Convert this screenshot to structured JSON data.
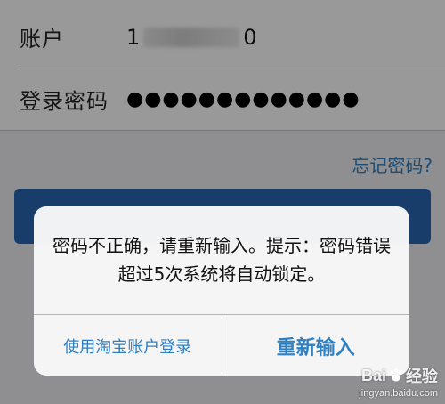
{
  "form": {
    "account": {
      "label": "账户",
      "value_prefix": "1",
      "value_suffix": "0"
    },
    "password": {
      "label": "登录密码",
      "masked_value": "●●●●●●●●●●●●●"
    }
  },
  "forgot_password_link": "忘记密码?",
  "alert": {
    "message": "密码不正确，请重新输入。提示：密码错误超过5次系统将自动锁定。",
    "buttons": {
      "secondary": "使用淘宝账户登录",
      "primary": "重新输入"
    }
  },
  "watermark": {
    "brand_left": "Bai",
    "brand_right": "经验",
    "url": "jingyan.baidu.com"
  },
  "colors": {
    "link_blue": "#2f7fc1",
    "login_button_blue": "#2b67b3"
  }
}
